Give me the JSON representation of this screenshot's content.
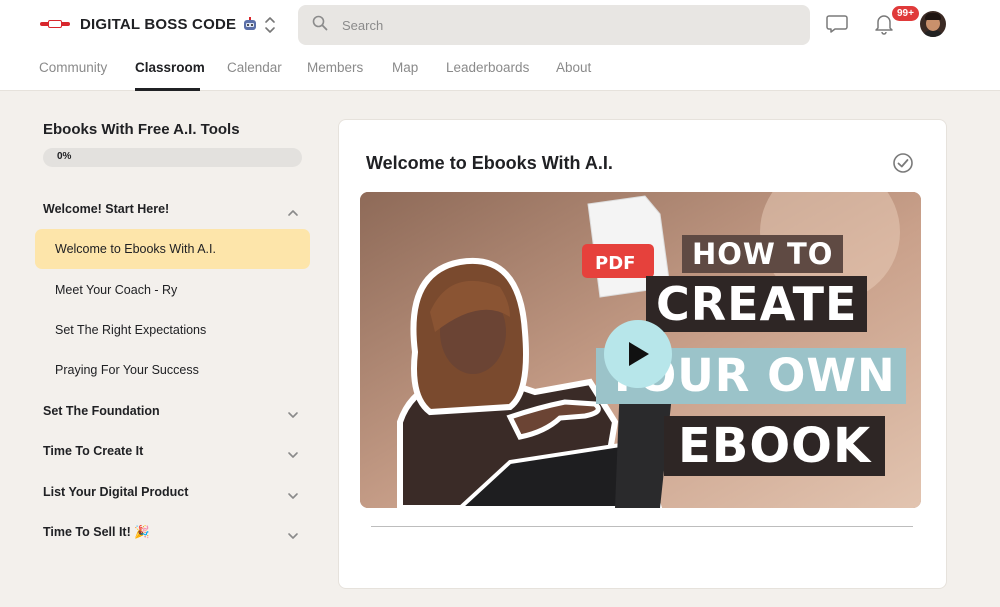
{
  "header": {
    "brand": "DIGITAL BOSS CODE",
    "search_placeholder": "Search",
    "notifications_badge": "99+"
  },
  "nav": {
    "tabs": [
      {
        "label": "Community"
      },
      {
        "label": "Classroom",
        "active": true
      },
      {
        "label": "Calendar"
      },
      {
        "label": "Members"
      },
      {
        "label": "Map"
      },
      {
        "label": "Leaderboards"
      },
      {
        "label": "About"
      }
    ]
  },
  "sidebar": {
    "course_title": "Ebooks With Free A.I. Tools",
    "progress_label": "0%",
    "progress_value": 0,
    "modules": [
      {
        "title": "Welcome! Start Here!",
        "expanded": true,
        "lessons": [
          "Welcome to Ebooks With A.I.",
          "Meet Your Coach - Ry",
          "Set The Right Expectations",
          "Praying For Your Success"
        ]
      },
      {
        "title": "Set The Foundation",
        "expanded": false
      },
      {
        "title": "Time To Create It",
        "expanded": false
      },
      {
        "title": "List Your Digital Product",
        "expanded": false
      },
      {
        "title": "Time To Sell It! 🎉",
        "expanded": false
      }
    ],
    "active_lesson": "Welcome to Ebooks With A.I."
  },
  "main": {
    "lesson_title": "Welcome to Ebooks With A.I.",
    "video": {
      "pdf_label": "PDF",
      "line1": "HOW TO",
      "line2": "CREATE",
      "line3": "YOUR OWN",
      "line4": "EBOOK"
    }
  },
  "colors": {
    "accent": "#fde5aa",
    "badge": "#e03a3a",
    "play": "#b7e6ea"
  }
}
